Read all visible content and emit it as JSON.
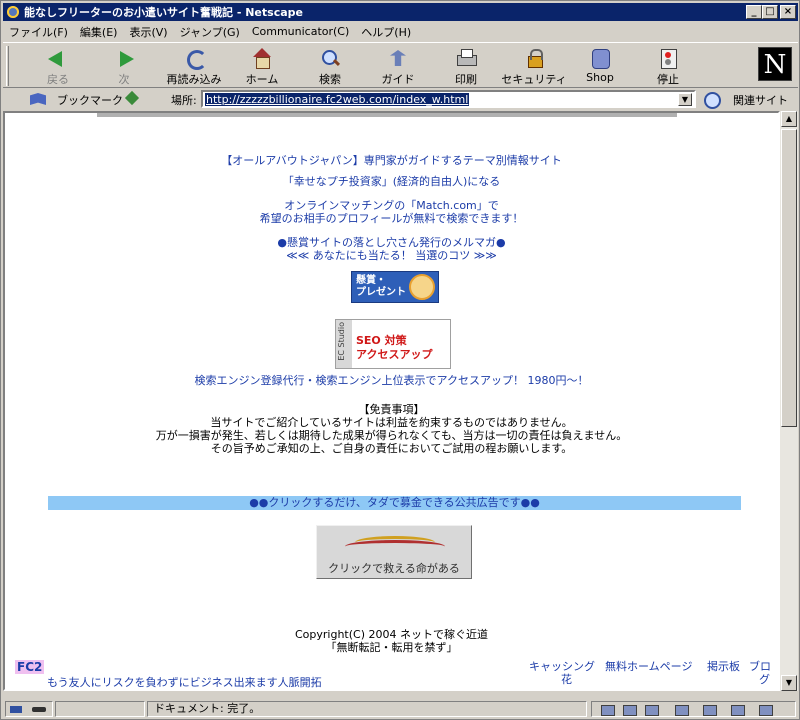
{
  "window": {
    "title": "能なしフリーターのお小遣いサイト奮戦記 - Netscape"
  },
  "menu": [
    "ファイル(F)",
    "編集(E)",
    "表示(V)",
    "ジャンプ(G)",
    "Communicator(C)",
    "ヘルプ(H)"
  ],
  "toolbar": {
    "back": "戻る",
    "forward": "次",
    "reload": "再読み込み",
    "home": "ホーム",
    "search": "検索",
    "guide": "ガイド",
    "print": "印刷",
    "security": "セキュリティ",
    "shop": "Shop",
    "stop": "停止",
    "logo": "N"
  },
  "location": {
    "bookmarks_label": "ブックマーク",
    "label": "場所:",
    "url": "http://zzzzzbillionaire.fc2web.com/index_w.html",
    "related_label": "関連サイト"
  },
  "content": {
    "link_allabout": "【オールアバウトジャパン】専門家がガイドするテーマ別情報サイト",
    "link_investor": "「幸せなプチ投資家」(経済的自由人)になる",
    "link_match_1": "オンラインマッチングの「Match.com」で",
    "link_match_2": "希望のお相手のプロフィールが無料で検索できます！",
    "link_mailmag_1": "●懸賞サイトの落とし穴さん発行のメルマガ●",
    "link_mailmag_2": "≪≪ あなたにも当たる！ 当選のコツ ≫≫",
    "banner_prize_1": "懸賞・",
    "banner_prize_2": "プレゼント",
    "banner_seo_side": "EC Studio",
    "banner_seo_1": "SEO 対策",
    "banner_seo_2": "アクセスアップ",
    "link_seo": "検索エンジン登録代行・検索エンジン上位表示でアクセスアップ！ 1980円～！",
    "disclaimer_title": "【免責事項】",
    "disclaimer_1": "当サイトでご紹介しているサイトは利益を約束するものではありません。",
    "disclaimer_2": "万が一損害が発生、若しくは期待した成果が得られなくても、当方は一切の責任は負えません。",
    "disclaimer_3": "その旨予めご承知の上、ご自身の責任においてご試用の程お願いします。",
    "ad_bar": "●●クリックするだけ、タダで募金できる公共広告です●●",
    "banner_donate": "クリックで救える命がある",
    "copyright_1": "Copyright(C) 2004 ネットで稼ぐ近道",
    "copyright_2": "「無断転記・転用を禁ず」",
    "fc2": "FC2",
    "fc2_link": "もう友人にリスクを負わずにビジネス出来ます人脈開拓",
    "footer_cashing_1": "キャッシング",
    "footer_cashing_2": "花",
    "footer_homepage": "無料ホームページ",
    "footer_bbs": "掲示板",
    "footer_blog_1": "ブロ",
    "footer_blog_2": "グ"
  },
  "status": {
    "text": "ドキュメント: 完了。"
  }
}
